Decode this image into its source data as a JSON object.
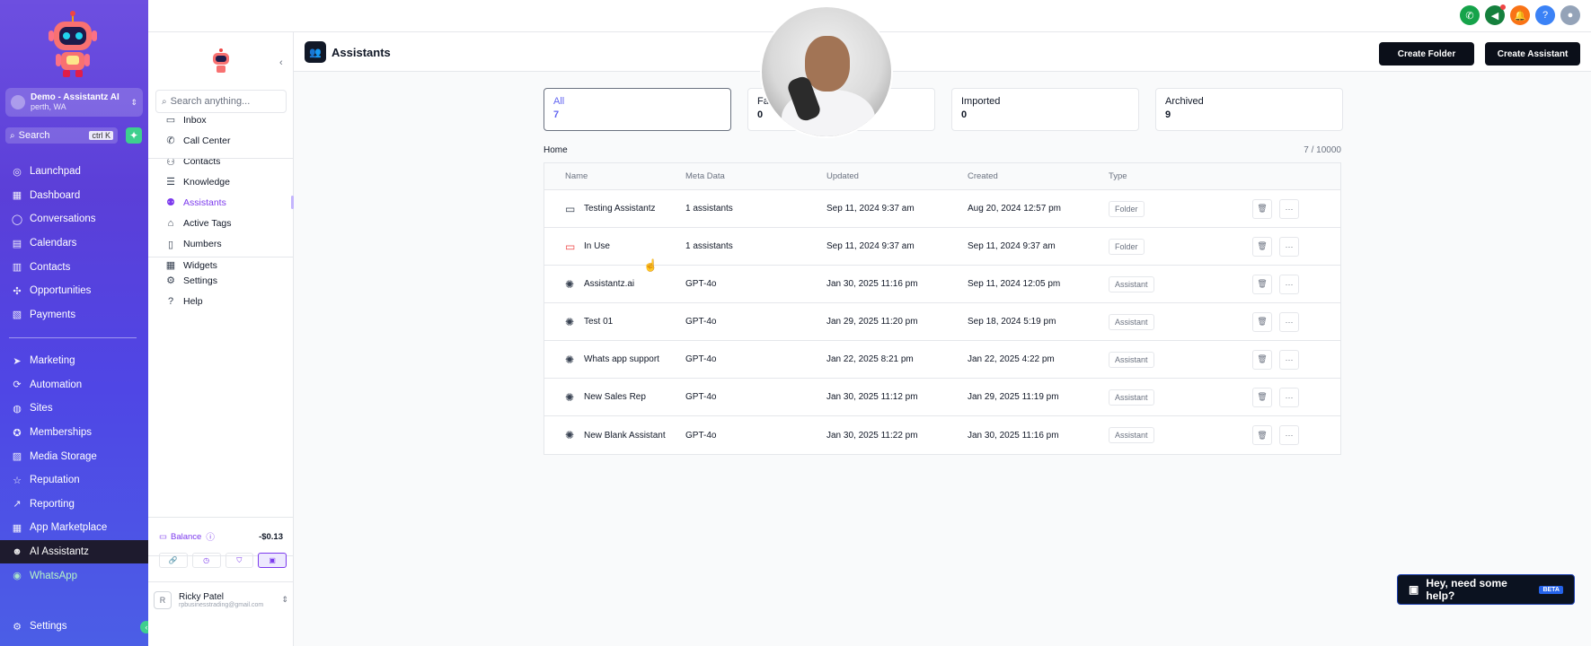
{
  "colors": {
    "accent": "#7c3aed",
    "sidebar": "#5b3fd8",
    "primary_button": "#0b0f19",
    "green": "#3ecf8e"
  },
  "global_sidebar": {
    "account_name": "Demo - Assistantz AI",
    "account_location": "perth, WA",
    "search_label": "Search",
    "search_shortcut": "ctrl K",
    "items_top": [
      {
        "label": "Launchpad",
        "icon": "launchpad-icon"
      },
      {
        "label": "Dashboard",
        "icon": "dashboard-icon"
      },
      {
        "label": "Conversations",
        "icon": "chat-icon"
      },
      {
        "label": "Calendars",
        "icon": "calendar-icon"
      },
      {
        "label": "Contacts",
        "icon": "contacts-icon"
      },
      {
        "label": "Opportunities",
        "icon": "opportunities-icon"
      },
      {
        "label": "Payments",
        "icon": "payments-icon"
      }
    ],
    "items_bottom": [
      {
        "label": "Marketing",
        "icon": "send-icon"
      },
      {
        "label": "Automation",
        "icon": "automation-icon"
      },
      {
        "label": "Sites",
        "icon": "globe-icon"
      },
      {
        "label": "Memberships",
        "icon": "badge-icon"
      },
      {
        "label": "Media Storage",
        "icon": "media-icon"
      },
      {
        "label": "Reputation",
        "icon": "star-icon"
      },
      {
        "label": "Reporting",
        "icon": "chart-icon"
      },
      {
        "label": "App Marketplace",
        "icon": "grid-icon"
      },
      {
        "label": "AI Assistantz",
        "icon": "robot-icon"
      },
      {
        "label": "WhatsApp",
        "icon": "whatsapp-icon"
      }
    ],
    "settings_label": "Settings"
  },
  "sub_sidebar": {
    "search_placeholder": "Search anything...",
    "group1": [
      "Inbox",
      "Call Center",
      "Contacts"
    ],
    "group2": [
      "Knowledge",
      "Assistants",
      "Active Tags",
      "Numbers",
      "Widgets"
    ],
    "group3": [
      "Settings",
      "Help"
    ],
    "balance_label": "Balance",
    "balance_amount": "-$0.13",
    "user_initial": "R",
    "user_name": "Ricky Patel",
    "user_email": "rpbusinesstrading@gmail.com"
  },
  "header": {
    "title": "Assistants",
    "create_folder": "Create Folder",
    "create_assistant": "Create Assistant"
  },
  "cards": [
    {
      "label": "All",
      "value": "7"
    },
    {
      "label": "Fa",
      "value": "0"
    },
    {
      "label": "Imported",
      "value": "0"
    },
    {
      "label": "Archived",
      "value": "9"
    }
  ],
  "breadcrumb": "Home",
  "count": "7 / 10000",
  "table": {
    "columns": [
      "Name",
      "Meta Data",
      "Updated",
      "Created",
      "Type"
    ],
    "rows": [
      {
        "name": "Testing Assistantz",
        "meta": "1 assistants",
        "updated": "Sep 11, 2024 9:37 am",
        "created": "Aug 20, 2024 12:57 pm",
        "type": "Folder"
      },
      {
        "name": "In Use",
        "meta": "1 assistants",
        "updated": "Sep 11, 2024 9:37 am",
        "created": "Sep 11, 2024 9:37 am",
        "type": "Folder"
      },
      {
        "name": "Assistantz.ai",
        "meta": "GPT-4o",
        "updated": "Jan 30, 2025 11:16 pm",
        "created": "Sep 11, 2024 12:05 pm",
        "type": "Assistant"
      },
      {
        "name": "Test 01",
        "meta": "GPT-4o",
        "updated": "Jan 29, 2025 11:20 pm",
        "created": "Sep 18, 2024 5:19 pm",
        "type": "Assistant"
      },
      {
        "name": "Whats app support",
        "meta": "GPT-4o",
        "updated": "Jan 22, 2025 8:21 pm",
        "created": "Jan 22, 2025 4:22 pm",
        "type": "Assistant"
      },
      {
        "name": "New Sales Rep",
        "meta": "GPT-4o",
        "updated": "Jan 30, 2025 11:12 pm",
        "created": "Jan 29, 2025 11:19 pm",
        "type": "Assistant"
      },
      {
        "name": "New Blank Assistant",
        "meta": "GPT-4o",
        "updated": "Jan 30, 2025 11:22 pm",
        "created": "Jan 30, 2025 11:16 pm",
        "type": "Assistant"
      }
    ]
  },
  "help_widget": {
    "label": "Hey, need some help?",
    "badge": "BETA"
  }
}
